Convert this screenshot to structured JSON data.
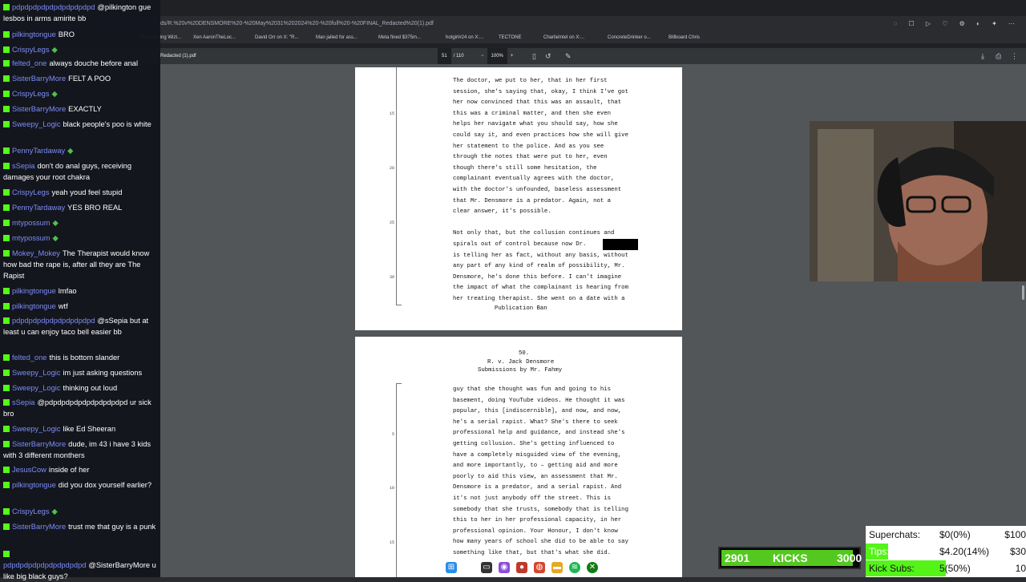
{
  "browser": {
    "address_fragment": "ds/R.%20v%20DENSMORE%20-%20May%2031%202024%20-%20full%20-%20FINAL_Redacted%20(1).pdf",
    "bookmarks": [
      "Investigating Wizt...",
      "Xen AaronTheLoc...",
      "David Orr on X: \"R...",
      "Man jailed for ass...",
      "Meta fined $375m...",
      "hotgirl#24 on X:...",
      "TECTONE",
      "CharlieIntel on X:...",
      "ConcreteDrinker o...",
      "Billboard Chris"
    ],
    "pdf_title": "Redacted (1).pdf",
    "page_current": "51",
    "page_total": "/ 110",
    "zoom": "100%"
  },
  "document": {
    "page1_lines": [
      "The doctor, we put to her, that in her first",
      "session, she's saying that, okay, I think I've got",
      "her now convinced that this was an assault, that",
      "this was a criminal matter, and then she even",
      "helps her navigate what you should say, how she",
      "could say it, and even practices how she will give",
      "her statement to the police.  And as you see",
      "through the notes that were put to her, even",
      "though there's still some hesitation, the",
      "complainant eventually agrees with the doctor,",
      "with the doctor's unfounded, baseless assessment",
      "that Mr. Densmore is a predator.  Again, not a",
      "clear answer, it's possible.",
      "",
      "Not only that, but the collusion continues and",
      "spirals out of control because now Dr.",
      "is telling her as fact, without any basis, without",
      "any part of any kind of realm of possibility, Mr.",
      "Densmore, he's done this before.  I can't imagine",
      "the impact of what the complainant is hearing from",
      "her treating therapist.  She went on a date with a"
    ],
    "page1_footer": "Publication Ban",
    "page1_line_numbers": [
      "15",
      "20",
      "25",
      "30"
    ],
    "page2_number": "50.",
    "page2_header1": "R. v. Jack Densmore",
    "page2_header2": "Submissions by Mr. Fahmy",
    "page2_lines": [
      "guy that she thought was fun and going to his",
      "basement, doing YouTube videos.  He thought it was",
      "popular, this [indiscernible], and now, and now,",
      "he's a serial rapist.  What?  She's there to seek",
      "professional help and guidance, and instead she's",
      "getting collusion.  She's getting influenced to",
      "have a completely misguided view of the evening,",
      "and more importantly, to – getting aid and more",
      "poorly to aid this view, an assessment that Mr.",
      "Densmore is a predator, and a serial rapist.  And",
      "it's not just anybody off the street.  This is",
      "somebody that she trusts, somebody that is telling",
      "this to her in her professional capacity, in her",
      "professional opinion.  Your Honour, I don't know",
      "how many years of school she did to be able to say",
      "something like that, but that's what she did."
    ],
    "page2_line_numbers": [
      "5",
      "10",
      "15"
    ]
  },
  "chat": [
    {
      "user": "pdpdpdpdpdpdpdpdpdpd",
      "text": "@pilkington gue lesbos in arms amirite bb"
    },
    {
      "user": "pilkingtongue",
      "text": "BRO"
    },
    {
      "user": "CrispyLegs",
      "text": ""
    },
    {
      "user": "felted_one",
      "text": "always douche before anal"
    },
    {
      "user": "SisterBarryMore",
      "text": "FELT A POO"
    },
    {
      "user": "CrispyLegs",
      "text": ""
    },
    {
      "user": "SisterBarryMore",
      "text": "EXACTLY"
    },
    {
      "user": "Sweepy_Logic",
      "text": "black people's poo is white"
    },
    {
      "user": "PennyTardaway",
      "text": ""
    },
    {
      "user": "sSepia",
      "text": "don't do anal guys, receiving damages your root chakra"
    },
    {
      "user": "CrispyLegs",
      "text": "yeah youd feel stupid"
    },
    {
      "user": "PennyTardaway",
      "text": "YES BRO REAL"
    },
    {
      "user": "mtypossum",
      "text": ""
    },
    {
      "user": "mtypossum",
      "text": ""
    },
    {
      "user": "Mokey_Mokey",
      "text": "The Therapist would know how bad the rape is, after all they are The Rapist"
    },
    {
      "user": "pilkingtongue",
      "text": "lmfao"
    },
    {
      "user": "pilkingtongue",
      "text": "wtf"
    },
    {
      "user": "pdpdpdpdpdpdpdpdpdpd",
      "text": "@sSepia but at least u can enjoy taco bell easier bb"
    },
    {
      "user": "felted_one",
      "text": "this is bottom slander"
    },
    {
      "user": "Sweepy_Logic",
      "text": "im just asking questions"
    },
    {
      "user": "Sweepy_Logic",
      "text": "thinking out loud"
    },
    {
      "user": "sSepia",
      "text": "@pdpdpdpdpdpdpdpdpdpd ur sick bro"
    },
    {
      "user": "Sweepy_Logic",
      "text": "like Ed Sheeran"
    },
    {
      "user": "SisterBarryMore",
      "text": "dude, im 43 i have 3 kids with 3 different monthers"
    },
    {
      "user": "JesusCow",
      "text": "inside of her"
    },
    {
      "user": "pilkingtongue",
      "text": "did you dox yourself earlier?"
    },
    {
      "user": "CrispyLegs",
      "text": ""
    },
    {
      "user": "SisterBarryMore",
      "text": "trust me that guy is a punk"
    },
    {
      "user": "pdpdpdpdpdpdpdpdpdpd",
      "text": "@SisterBarryMore u like big black guys?"
    }
  ],
  "kicks": {
    "count": "2901",
    "label": "KICKS",
    "goal": "3000",
    "progress": 0.967
  },
  "stats": {
    "superchats": {
      "label": "Superchats:",
      "value": "$0(0%)",
      "goal": "$100",
      "progress": 0.0
    },
    "tips": {
      "label": "Tips:",
      "value": "$4.20(14%)",
      "goal": "$30",
      "progress": 0.14
    },
    "kick_subs": {
      "label": "Kick Subs:",
      "value": "5(50%)",
      "goal": "10",
      "progress": 0.5
    }
  },
  "colors": {
    "kick_green": "#53fc18",
    "chat_user": "#7b8cf5",
    "pdf_bg": "#525659"
  }
}
